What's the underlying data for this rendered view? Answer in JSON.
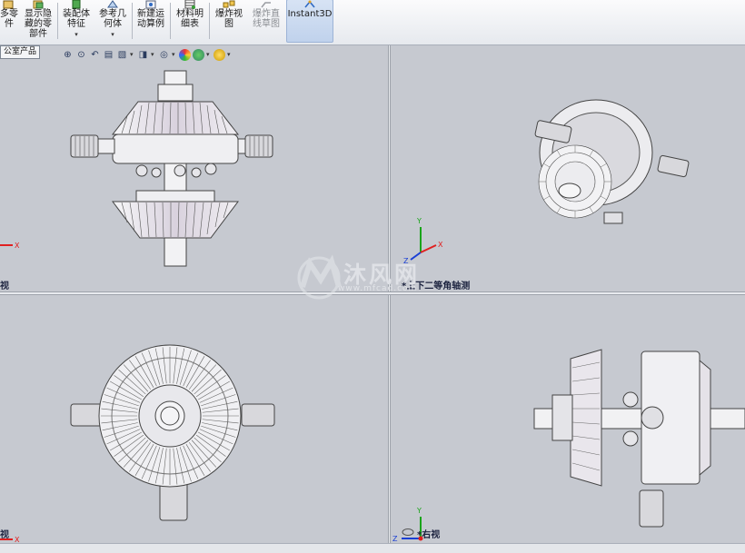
{
  "ribbon": {
    "buttons": [
      {
        "label": "多零\n件",
        "disabled": false
      },
      {
        "label": "显示隐\n藏的零\n部件",
        "disabled": false
      },
      {
        "label": "装配体\n特征",
        "disabled": false,
        "dropdown": "▾"
      },
      {
        "label": "参考几\n何体",
        "disabled": false,
        "dropdown": "▾"
      },
      {
        "label": "新建运\n动算例",
        "disabled": false
      },
      {
        "label": "材料明\n细表",
        "disabled": false
      },
      {
        "label": "爆炸视\n图",
        "disabled": false
      },
      {
        "label": "爆炸直\n线草图",
        "disabled": true
      },
      {
        "label": "Instant3D",
        "disabled": false,
        "active": true
      }
    ]
  },
  "tree_tab": "公室产品",
  "views": {
    "top_left_label": "视",
    "top_right_label": "*上下二等角轴测",
    "bottom_left_label": "视",
    "bottom_right_label": "*右视"
  },
  "triad": {
    "x": "X",
    "y": "Y",
    "z": "Z"
  },
  "watermark": {
    "text": "沐风网",
    "url": "www.mfcad.com"
  },
  "colors": {
    "viewport_bg": "#c6c9d0",
    "triad_x": "#e02020",
    "triad_y": "#1aa41a",
    "triad_z": "#1a3fd4"
  }
}
